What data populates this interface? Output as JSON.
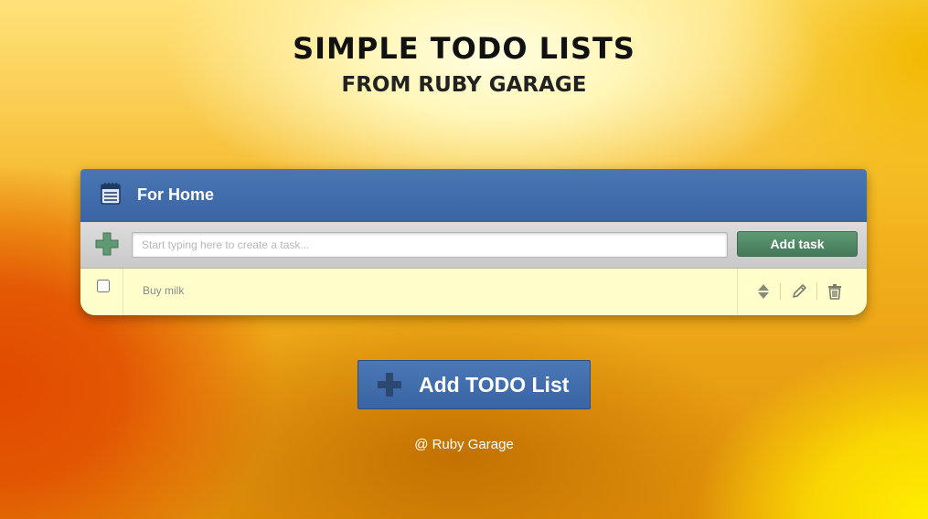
{
  "header": {
    "title": "SIMPLE TODO LISTS",
    "subtitle": "FROM RUBY GARAGE"
  },
  "todo_list": {
    "title": "For Home",
    "header_icon": "notepad-icon",
    "add_icon": "plus-icon",
    "input": {
      "placeholder": "Start typing here to create a task...",
      "value": ""
    },
    "add_task_label": "Add task",
    "tasks": [
      {
        "text": "Buy milk",
        "done": false,
        "actions": [
          "sort-icon",
          "edit-icon",
          "trash-icon"
        ]
      }
    ]
  },
  "add_list_button": {
    "label": "Add TODO List",
    "icon": "plus-icon"
  },
  "footer": {
    "text": "@ Ruby Garage"
  },
  "colors": {
    "header_blue": "#3a64a3",
    "add_task_green": "#4a8060",
    "task_bg": "#ffffcc",
    "plus_green": "#5f9a74",
    "plus_dark_blue": "#2c4770"
  }
}
